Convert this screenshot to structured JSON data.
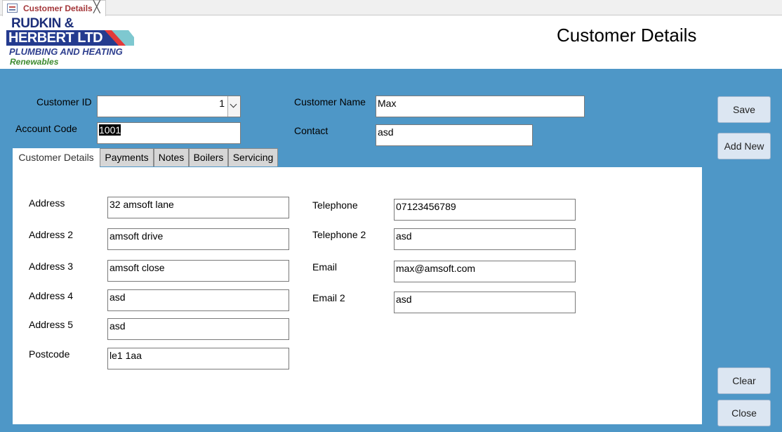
{
  "doc_tab": {
    "label": "Customer Details",
    "close_glyph": "╳"
  },
  "logo": {
    "line1": "RUDKIN &",
    "line2": "HERBERT LTD",
    "line3": "PLUMBING AND HEATING",
    "line4": "Renewables"
  },
  "form": {
    "title": "Customer Details"
  },
  "header_fields": {
    "customer_id_label": "Customer ID",
    "customer_id_value": "1",
    "account_code_label": "Account Code",
    "account_code_value": "1001",
    "customer_name_label": "Customer Name",
    "customer_name_value": "Max",
    "contact_label": "Contact",
    "contact_value": "asd"
  },
  "tabs": [
    {
      "label": "Customer Details",
      "active": true
    },
    {
      "label": "Payments",
      "active": false
    },
    {
      "label": "Notes",
      "active": false
    },
    {
      "label": "Boilers",
      "active": false
    },
    {
      "label": "Servicing",
      "active": false
    }
  ],
  "address": [
    {
      "label": "Address",
      "value": "32 amsoft lane"
    },
    {
      "label": "Address 2",
      "value": "amsoft drive"
    },
    {
      "label": "Address 3",
      "value": "amsoft close"
    },
    {
      "label": "Address 4",
      "value": "asd"
    },
    {
      "label": "Address 5",
      "value": "asd"
    },
    {
      "label": "Postcode",
      "value": "le1 1aa"
    }
  ],
  "contact_info": [
    {
      "label": "Telephone",
      "value": "07123456789"
    },
    {
      "label": "Telephone 2",
      "value": "asd"
    },
    {
      "label": "Email",
      "value": "max@amsoft.com"
    },
    {
      "label": "Email 2",
      "value": "asd"
    }
  ],
  "buttons": {
    "save": "Save",
    "add_new": "Add New",
    "clear": "Clear",
    "close": "Close"
  },
  "colors": {
    "form_background": "#4e97c7",
    "tab_label": "#a4373a",
    "button_face": "#dce6f2"
  }
}
